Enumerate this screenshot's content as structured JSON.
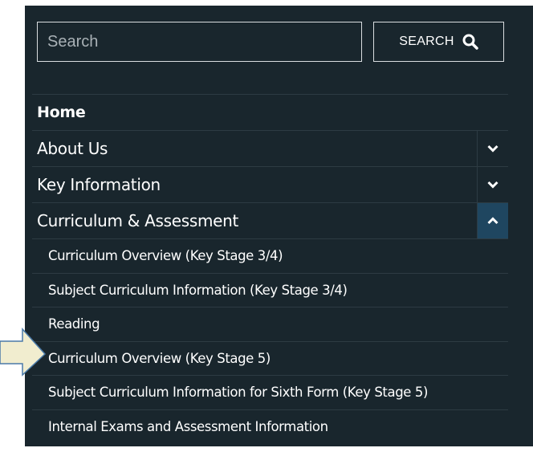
{
  "search": {
    "placeholder": "Search",
    "button_label": "SEARCH",
    "button_icon": "search-icon"
  },
  "nav": {
    "items": [
      {
        "label": "Home"
      },
      {
        "label": "About Us",
        "toggle_icon": "chevron-down-icon"
      },
      {
        "label": "Key Information",
        "toggle_icon": "chevron-down-icon"
      },
      {
        "label": "Curriculum & Assessment",
        "toggle_icon": "chevron-up-icon",
        "expanded": true
      }
    ],
    "subitems": [
      {
        "label": "Curriculum Overview (Key Stage 3/4)"
      },
      {
        "label": "Subject Curriculum Information (Key Stage 3/4)"
      },
      {
        "label": "Reading"
      },
      {
        "label": "Curriculum Overview (Key Stage 5)"
      },
      {
        "label": "Subject Curriculum Information for Sixth Form (Key Stage 5)"
      },
      {
        "label": "Internal Exams and Assessment Information"
      }
    ]
  },
  "colors": {
    "panel_bg": "#19262d",
    "expanded_toggle_bg": "#1f4660",
    "arrow_fill": "#f1edcf"
  }
}
